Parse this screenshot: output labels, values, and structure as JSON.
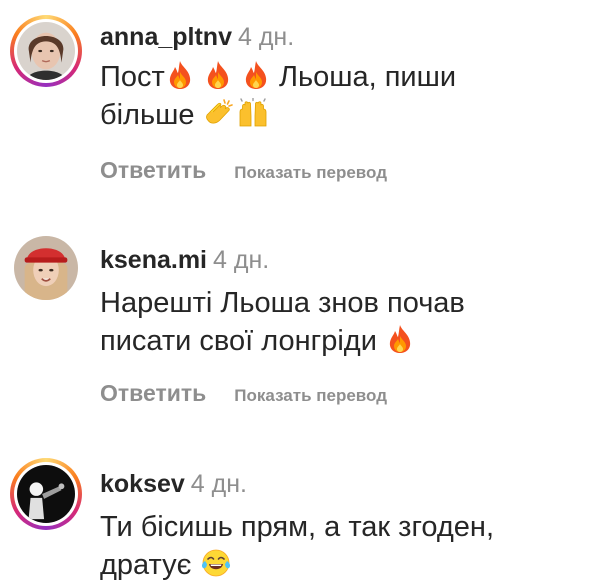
{
  "comments": [
    {
      "username": "anna_pltnv",
      "age": "4 дн.",
      "text_lines": [
        "Пост",
        "Льоша, пиши",
        "більше"
      ],
      "emojis_line1": [
        "fire-emoji",
        "fire-emoji",
        "fire-emoji"
      ],
      "emojis_line2": [
        "clapping-hands-emoji",
        "raising-hands-emoji"
      ],
      "reply_label": "Ответить",
      "translate_label": "Показать перевод",
      "has_story_ring": true
    },
    {
      "username": "ksena.mi",
      "age": "4 дн.",
      "text_lines": [
        "Нарешті Льоша знов почав",
        "писати свої лонгріди"
      ],
      "emojis_line2": [
        "fire-emoji"
      ],
      "reply_label": "Ответить",
      "translate_label": "Показать перевод",
      "has_story_ring": false
    },
    {
      "username": "koksev",
      "age": "4 дн.",
      "text_lines": [
        "Ти бісишь прям, а так згоден,",
        "дратує"
      ],
      "emojis_line2": [
        "tears-of-joy-emoji"
      ],
      "has_story_ring": true
    }
  ],
  "colors": {
    "text": "#262626",
    "muted": "#8e8e8e",
    "story_ring": [
      "#feda75",
      "#fa7e1e",
      "#d62976",
      "#962fbf"
    ]
  }
}
